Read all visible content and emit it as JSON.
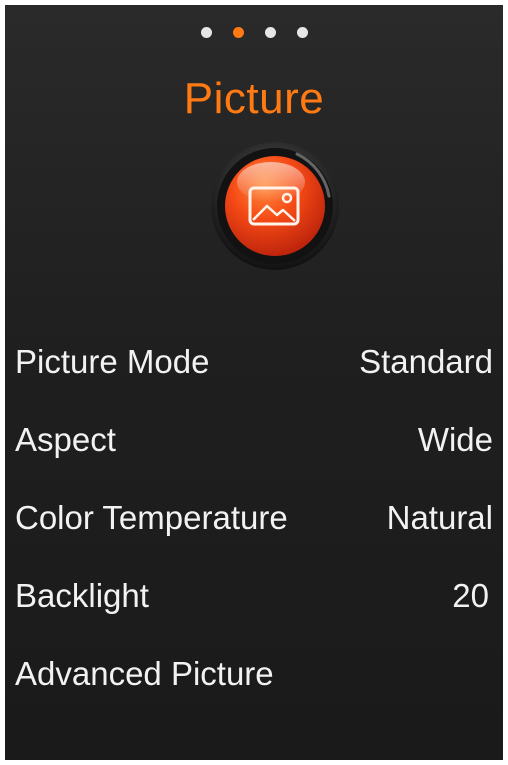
{
  "pager": {
    "dots": [
      {
        "state": "inactive"
      },
      {
        "state": "active"
      },
      {
        "state": "inactive"
      },
      {
        "state": "inactive"
      }
    ],
    "active_color": "#ff7a12",
    "inactive_color": "#e6e6e6"
  },
  "header": {
    "title": "Picture",
    "title_color": "#ff7a12",
    "icon": "image-icon"
  },
  "menu": {
    "items": [
      {
        "label": "Picture Mode",
        "value": "Standard"
      },
      {
        "label": "Aspect",
        "value": "Wide"
      },
      {
        "label": "Color Temperature",
        "value": "Natural"
      },
      {
        "label": "Backlight",
        "value": "20"
      },
      {
        "label": "Advanced Picture",
        "value": ""
      }
    ]
  }
}
